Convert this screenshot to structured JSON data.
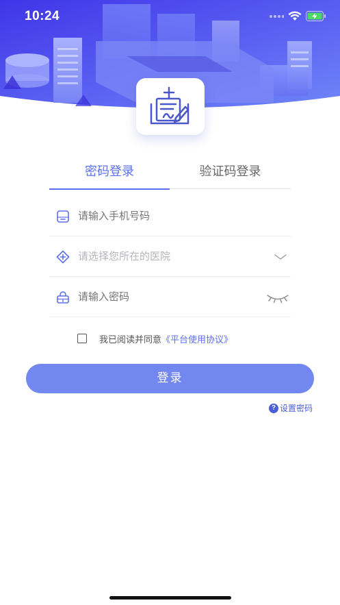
{
  "status_bar": {
    "time": "10:24"
  },
  "tabs": {
    "password_login": "密码登录",
    "code_login": "验证码登录"
  },
  "form": {
    "phone_placeholder": "请输入手机号码",
    "hospital_placeholder": "请选择您所在的医院",
    "password_placeholder": "请输入密码"
  },
  "agreement": {
    "prefix": "我已阅读并同意",
    "link": "《平台使用协议》"
  },
  "login_button": "登录",
  "set_password": "设置密码",
  "colors": {
    "accent": "#5b6ff0",
    "button": "#7387f0",
    "banner_from": "#4a3ff0",
    "banner_to": "#6f7cf7"
  }
}
